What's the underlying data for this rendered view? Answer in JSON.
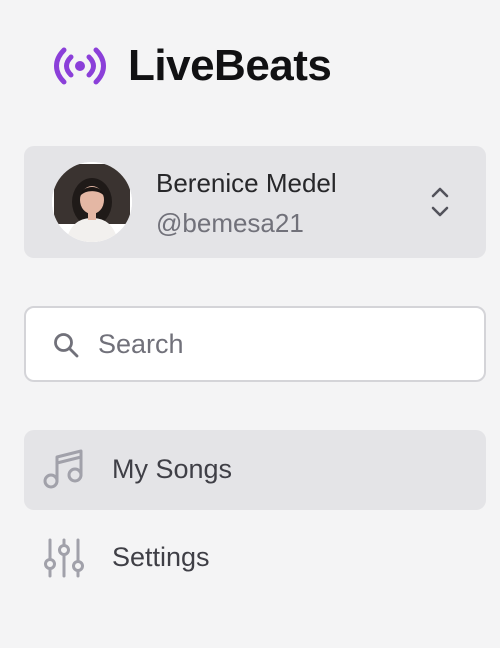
{
  "app": {
    "name": "LiveBeats",
    "brand_color": "#8b3fd9"
  },
  "user": {
    "name": "Berenice Medel",
    "handle": "@bemesa21",
    "avatar_icon": "user-avatar-photo",
    "selector_icon": "chevron-up-down-icon"
  },
  "search": {
    "placeholder": "Search",
    "value": ""
  },
  "nav": {
    "items": [
      {
        "label": "My Songs",
        "icon": "music-note-icon",
        "active": true
      },
      {
        "label": "Settings",
        "icon": "sliders-icon",
        "active": false
      }
    ]
  }
}
